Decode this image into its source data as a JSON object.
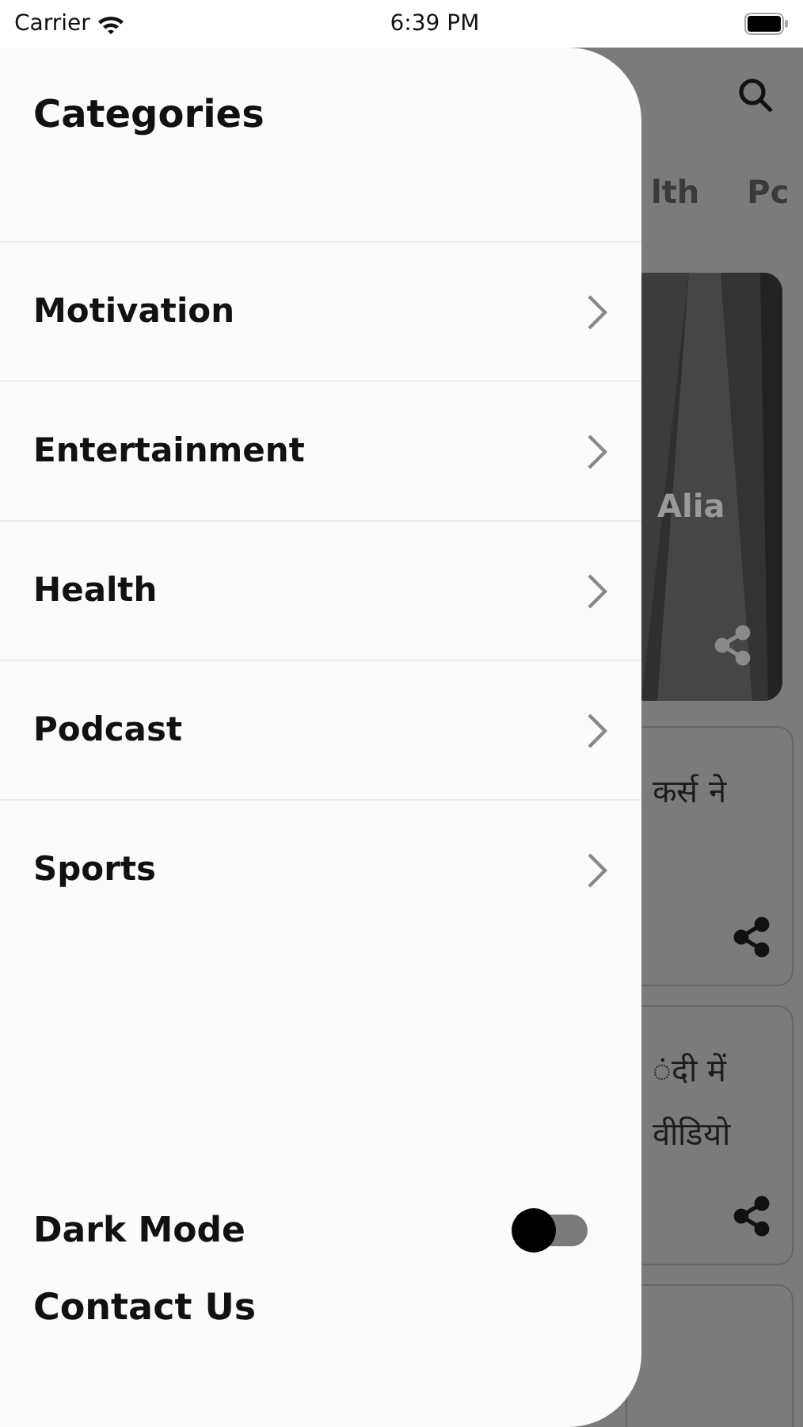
{
  "status_bar": {
    "carrier": "Carrier",
    "time": "6:39 PM"
  },
  "background": {
    "tabs": [
      "lth",
      "Pc"
    ],
    "cards": [
      {
        "kind": "picture",
        "lines": [
          "Alia"
        ]
      },
      {
        "kind": "text",
        "lines": [
          "कर्स ने"
        ]
      },
      {
        "kind": "text",
        "lines": [
          "ंदी में",
          "वीडियो"
        ]
      },
      {
        "kind": "blank"
      }
    ]
  },
  "drawer": {
    "title": "Categories",
    "items": [
      {
        "label": "Motivation"
      },
      {
        "label": "Entertainment"
      },
      {
        "label": "Health"
      },
      {
        "label": "Podcast"
      },
      {
        "label": "Sports"
      }
    ],
    "dark_mode": {
      "label": "Dark Mode",
      "on": false
    },
    "contact": "Contact Us"
  }
}
